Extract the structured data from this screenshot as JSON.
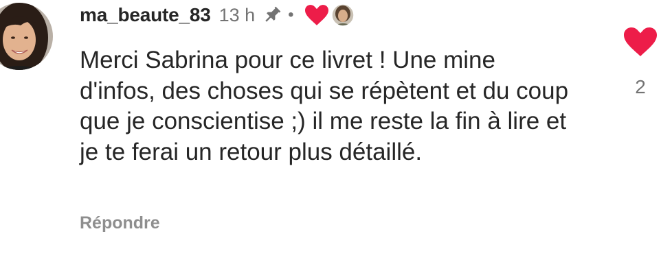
{
  "comment": {
    "username": "ma_beaute_83",
    "time": "13 h",
    "separator": "•",
    "text": "Merci Sabrina pour ce livret ! Une mine d'infos, des choses qui se répètent et du coup que je conscientise ;) il me reste la fin à lire et je te ferai un retour plus détaillé.",
    "reply_label": "Répondre",
    "like_count": "2",
    "pinned": true,
    "liked_by_creator": true
  },
  "icons": {
    "avatar": "user-avatar",
    "pin": "pin-icon",
    "creator_like": "heart-icon",
    "creator_avatar": "creator-avatar",
    "like": "heart-icon"
  },
  "colors": {
    "heart": "#ED1D49",
    "username": "#262626",
    "muted": "#737373",
    "reply": "#8E8E8E"
  }
}
